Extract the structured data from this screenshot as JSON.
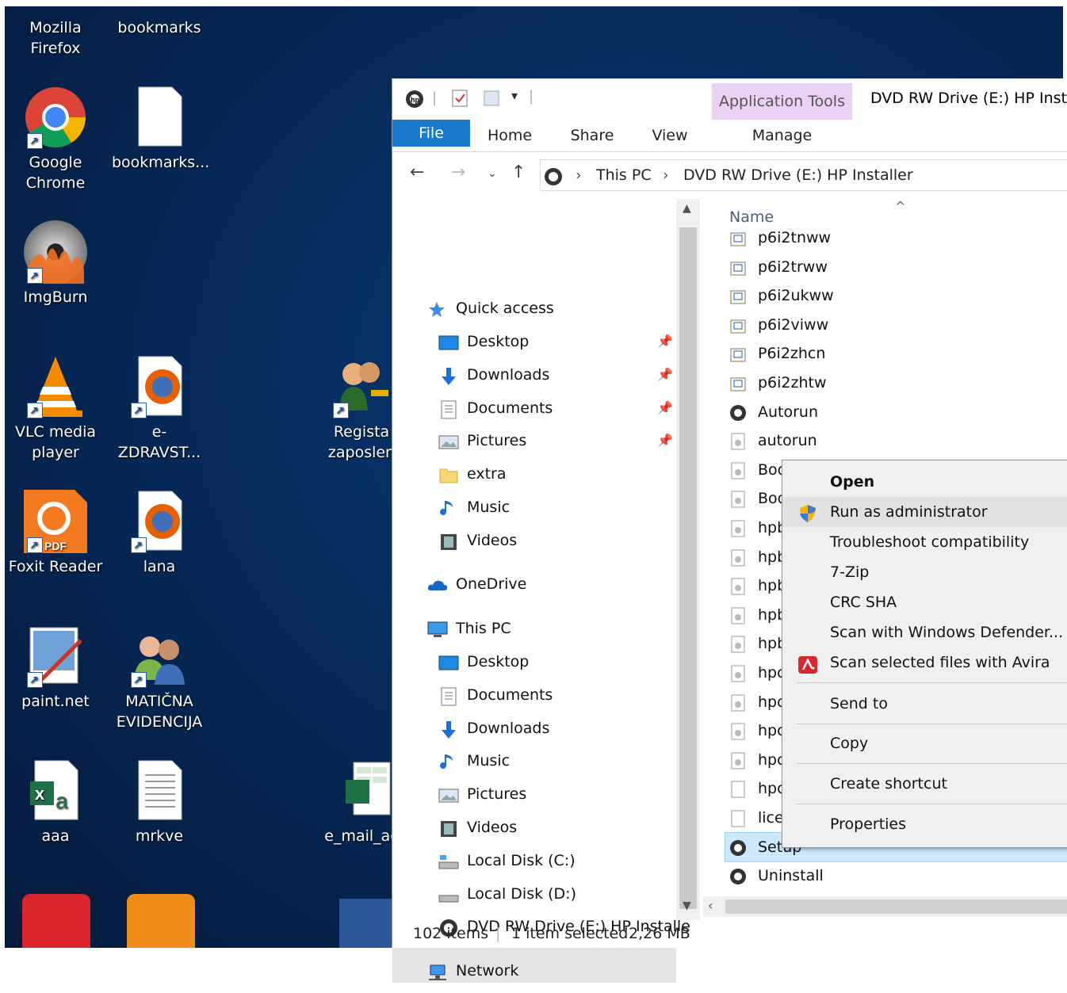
{
  "desktop": {
    "icons": [
      {
        "label": "Mozilla Firefox",
        "icon": "firefox-icon"
      },
      {
        "label": "bookmarks",
        "icon": "file-icon"
      },
      {
        "label": "Google Chrome",
        "icon": "chrome-icon"
      },
      {
        "label": "bookmarks...",
        "icon": "file-icon"
      },
      {
        "label": "ImgBurn",
        "icon": "imgburn-icon"
      },
      {
        "label": "VLC media player",
        "icon": "vlc-icon"
      },
      {
        "label": "e-ZDRAVST...",
        "icon": "firefox-doc-icon"
      },
      {
        "label": "Regista zaposlen",
        "icon": "users-key-icon"
      },
      {
        "label": "Foxit Reader",
        "icon": "foxit-icon"
      },
      {
        "label": "lana",
        "icon": "firefox-doc-icon"
      },
      {
        "label": "paint.net",
        "icon": "paintnet-icon"
      },
      {
        "label": "MATIČNA EVIDENCIJA",
        "icon": "people-icon"
      },
      {
        "label": "aaa",
        "icon": "excel-icon"
      },
      {
        "label": "mrkve",
        "icon": "text-file-icon"
      },
      {
        "label": "e_mail_ac",
        "icon": "excel-sheet-icon"
      }
    ]
  },
  "explorer": {
    "title": "DVD RW Drive (E:) HP Insta",
    "contextual_tab": "Application Tools",
    "tabs": [
      "File",
      "Home",
      "Share",
      "View",
      "Manage"
    ],
    "breadcrumb": [
      "This PC",
      "DVD RW Drive (E:) HP Installer"
    ],
    "nav": {
      "quick_access": "Quick access",
      "qa_items": [
        "Desktop",
        "Downloads",
        "Documents",
        "Pictures",
        "extra",
        "Music",
        "Videos"
      ],
      "onedrive": "OneDrive",
      "this_pc": "This PC",
      "pc_items": [
        "Desktop",
        "Documents",
        "Downloads",
        "Music",
        "Pictures",
        "Videos",
        "Local Disk (C:)",
        "Local Disk (D:)",
        "DVD RW Drive (E:) HP Installe"
      ],
      "network": "Network"
    },
    "column_header": "Name",
    "files": [
      "p6i2tnww",
      "p6i2trww",
      "p6i2ukww",
      "p6i2viww",
      "P6i2zhcn",
      "p6i2zhtw",
      "Autorun",
      "autorun",
      "Boo",
      "Boo",
      "hpb",
      "hpb",
      "hpb",
      "hpb",
      "hpb",
      "hpc",
      "hpc",
      "hpc",
      "hpc",
      "hpc",
      "lice",
      "Setup",
      "Uninstall"
    ],
    "status": {
      "items": "102 items",
      "selected": "1 item selected",
      "size": "2,26 MB"
    }
  },
  "context_menu": {
    "items": [
      "Open",
      "Run as administrator",
      "Troubleshoot compatibility",
      "7-Zip",
      "CRC SHA",
      "Scan with Windows Defender...",
      "Scan selected files with Avira",
      "Send to",
      "Copy",
      "Create shortcut",
      "Properties"
    ]
  }
}
